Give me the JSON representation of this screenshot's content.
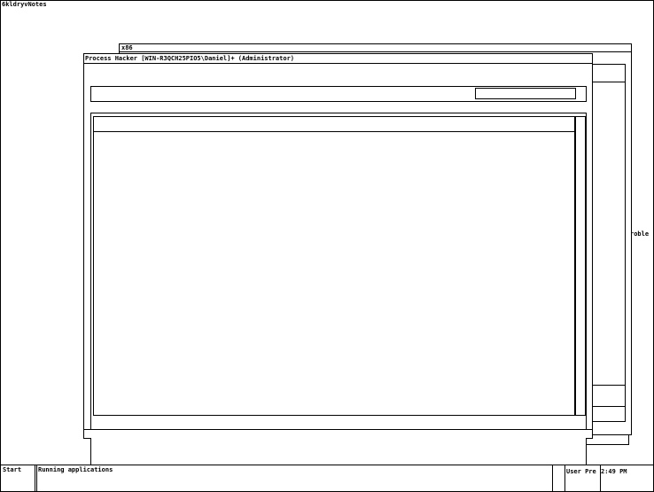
{
  "desktop": {
    "corner_label": "6kldryvNotes"
  },
  "background_window": {
    "title": "x86",
    "partial_text": "roble"
  },
  "main_window": {
    "title": "Process Hacker [WIN-R3QCH25PIO5\\Daniel]+ (Administrator)",
    "search": {
      "value": ""
    }
  },
  "taskbar": {
    "start_label": "Start",
    "running_label": "Running applications",
    "user_label": "User Pre",
    "clock": "2:49 PM"
  }
}
